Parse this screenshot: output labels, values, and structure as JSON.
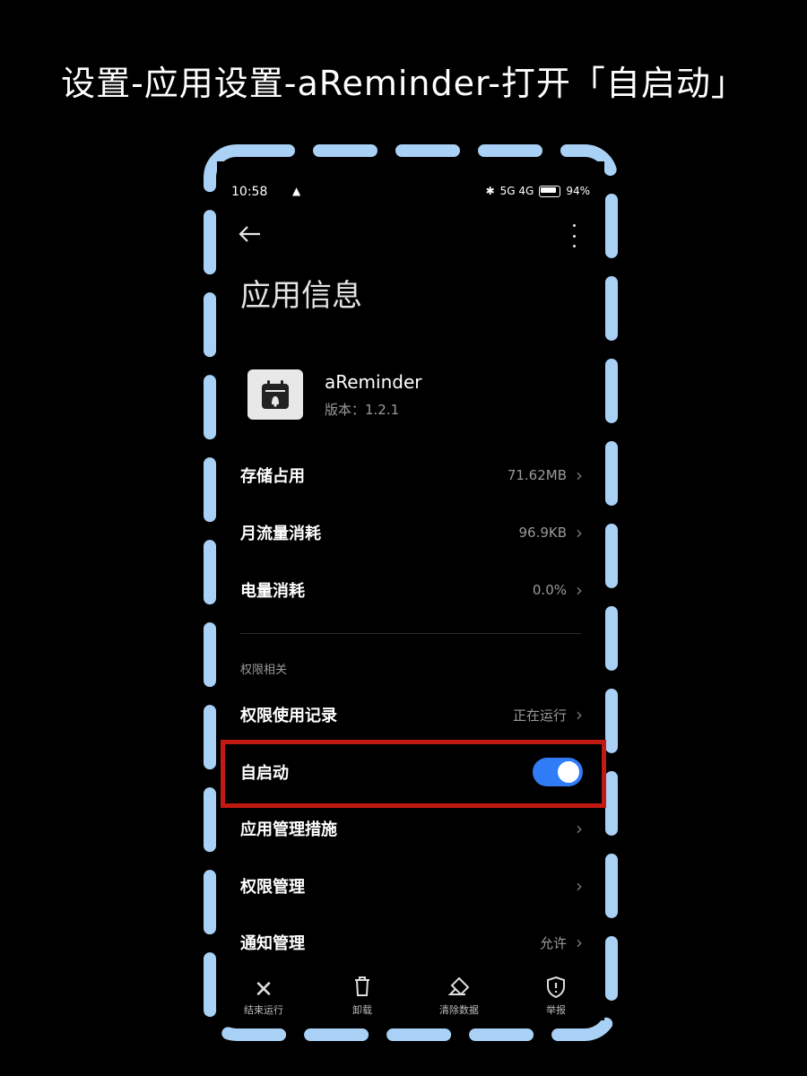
{
  "caption": "设置-应用设置-aReminder-打开「自启动」",
  "status_bar": {
    "time": "10:58",
    "network": "5G 4G",
    "battery": "94%"
  },
  "page_title": "应用信息",
  "app": {
    "name": "aReminder",
    "version": "版本：1.2.1"
  },
  "rows": {
    "storage": {
      "label": "存储占用",
      "value": "71.62MB"
    },
    "data_usage": {
      "label": "月流量消耗",
      "value": "96.9KB"
    },
    "battery_usage": {
      "label": "电量消耗",
      "value": "0.0%"
    }
  },
  "permissions_section": {
    "title": "权限相关",
    "usage_record": {
      "label": "权限使用记录",
      "value": "正在运行"
    },
    "autostart": {
      "label": "自启动",
      "enabled": true
    },
    "management_measures": {
      "label": "应用管理措施"
    },
    "permission_management": {
      "label": "权限管理"
    },
    "notification_management": {
      "label": "通知管理",
      "value": "允许"
    }
  },
  "bottom_actions": {
    "force_stop": "结束运行",
    "uninstall": "卸载",
    "clear_data": "清除数据",
    "report": "举报"
  },
  "colors": {
    "toggle_on": "#2f7cf6",
    "highlight_border": "#c01a12",
    "dash_border": "#a9d0f5"
  }
}
